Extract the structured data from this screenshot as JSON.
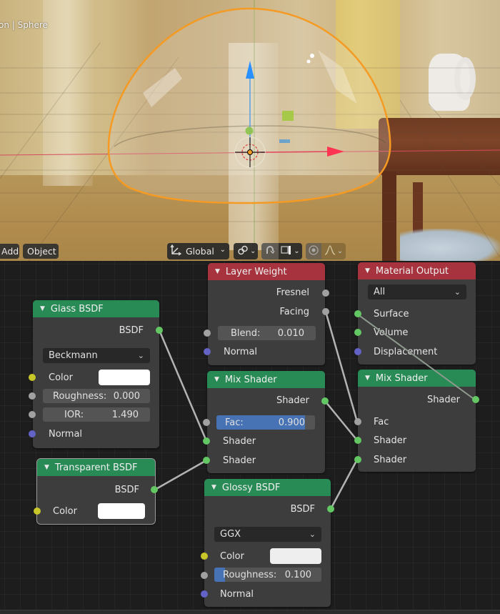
{
  "viewport": {
    "object_info": "on | Sphere",
    "header": {
      "add_label": "Add",
      "object_label": "Object",
      "orientation_icon": "transform-orientation-icon",
      "orientation_value": "Global",
      "pivot_icon": "pivot-link-icon",
      "snap_icon": "snap-magnet-icon",
      "snap_target_icon": "snap-increment-icon",
      "proportional_icon": "proportional-edit-icon",
      "falloff_icon": "falloff-curve-icon"
    },
    "colors": {
      "selection_outline": "#f59a23",
      "axis_x": "#ff3352",
      "axis_y": "#8bdc00",
      "axis_z": "#2890ff"
    }
  },
  "nodes": {
    "glass_bsdf": {
      "title": "Glass BSDF",
      "output": "BSDF",
      "distribution": "Beckmann",
      "color_label": "Color",
      "color_value": "#ffffff",
      "roughness_label": "Roughness:",
      "roughness_value": "0.000",
      "ior_label": "IOR:",
      "ior_value": "1.490",
      "normal_label": "Normal"
    },
    "transparent_bsdf": {
      "title": "Transparent BSDF",
      "output": "BSDF",
      "color_label": "Color",
      "color_value": "#ffffff"
    },
    "layer_weight": {
      "title": "Layer Weight",
      "output_fresnel": "Fresnel",
      "output_facing": "Facing",
      "blend_label": "Blend:",
      "blend_value": "0.010",
      "normal_label": "Normal"
    },
    "mix_shader_1": {
      "title": "Mix Shader",
      "output": "Shader",
      "fac_label": "Fac:",
      "fac_value": "0.900",
      "fac_fraction": 0.9,
      "input_1": "Shader",
      "input_2": "Shader"
    },
    "glossy_bsdf": {
      "title": "Glossy BSDF",
      "output": "BSDF",
      "distribution": "GGX",
      "color_label": "Color",
      "color_value": "#eeeeee",
      "roughness_label": "Roughness:",
      "roughness_value": "0.100",
      "roughness_fraction": 0.1,
      "normal_label": "Normal"
    },
    "material_output": {
      "title": "Material Output",
      "target": "All",
      "surface_label": "Surface",
      "volume_label": "Volume",
      "displacement_label": "Displacement"
    },
    "mix_shader_2": {
      "title": "Mix Shader",
      "output": "Shader",
      "fac_label": "Fac",
      "input_1": "Shader",
      "input_2": "Shader"
    }
  },
  "links": [
    {
      "from": "glass_bsdf.BSDF",
      "to": "mix_shader_1.Shader1"
    },
    {
      "from": "transparent_bsdf.BSDF",
      "to": "mix_shader_1.Shader2"
    },
    {
      "from": "layer_weight.Facing",
      "to": "mix_shader_2.Fac"
    },
    {
      "from": "mix_shader_1.Shader",
      "to": "mix_shader_2.Shader1"
    },
    {
      "from": "glossy_bsdf.BSDF",
      "to": "mix_shader_2.Shader2"
    },
    {
      "from": "mix_shader_2.Shader",
      "to": "material_output.Surface"
    }
  ],
  "node_colors": {
    "shader_header": "#288a55",
    "output_header": "#a6333e",
    "socket_shader": "#63c763",
    "socket_float": "#a1a1a1",
    "socket_color": "#c7c729",
    "socket_vector": "#6363c7",
    "slider_fill": "#4772b3"
  }
}
